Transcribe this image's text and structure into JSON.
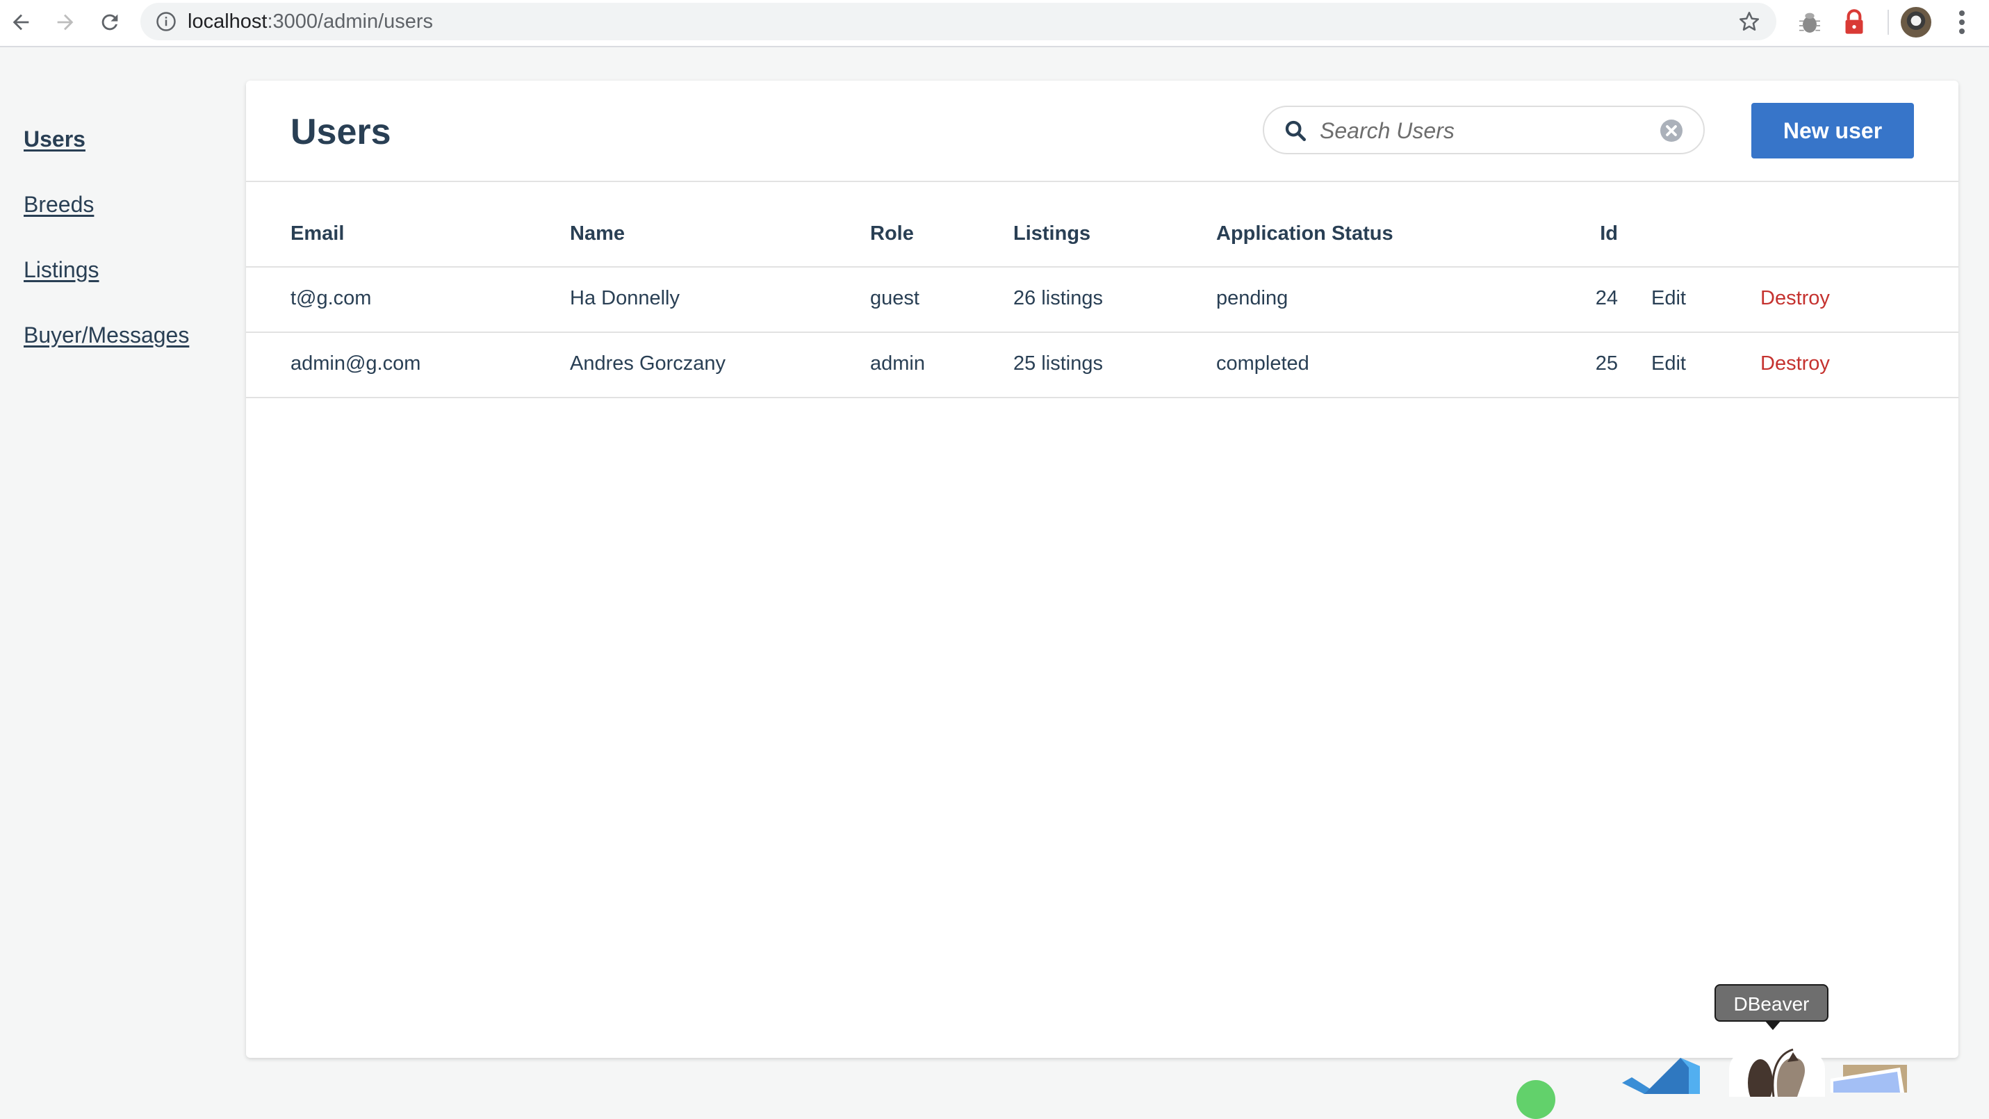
{
  "browser": {
    "url_host": "localhost",
    "url_rest": ":3000/admin/users",
    "icons": [
      "back-arrow-icon",
      "forward-arrow-icon",
      "reload-icon",
      "info-icon",
      "star-icon",
      "bug-extension-icon",
      "lock-extension-icon",
      "profile-avatar",
      "more-menu-icon"
    ]
  },
  "sidebar": {
    "items": [
      {
        "label": "Users",
        "active": true
      },
      {
        "label": "Breeds",
        "active": false
      },
      {
        "label": "Listings",
        "active": false
      },
      {
        "label": "Buyer/Messages",
        "active": false
      }
    ]
  },
  "header": {
    "title": "Users",
    "search_placeholder": "Search Users",
    "search_value": "",
    "new_button_label": "New user"
  },
  "table": {
    "columns": [
      "Email",
      "Name",
      "Role",
      "Listings",
      "Application Status",
      "Id"
    ],
    "rows": [
      {
        "email": "t@g.com",
        "name": "Ha Donnelly",
        "role": "guest",
        "listings": "26 listings",
        "status": "pending",
        "id": "24",
        "edit": "Edit",
        "destroy": "Destroy"
      },
      {
        "email": "admin@g.com",
        "name": "Andres Gorczany",
        "role": "admin",
        "listings": "25 listings",
        "status": "completed",
        "id": "25",
        "edit": "Edit",
        "destroy": "Destroy"
      }
    ]
  },
  "colors": {
    "primary": "#3775c9",
    "text": "#293f54",
    "danger": "#c5322f",
    "background": "#f5f6f6"
  },
  "dock": {
    "tooltip": "DBeaver",
    "apps": [
      "green-app-icon",
      "vscode-icon",
      "dbeaver-icon",
      "preview-icon"
    ]
  }
}
